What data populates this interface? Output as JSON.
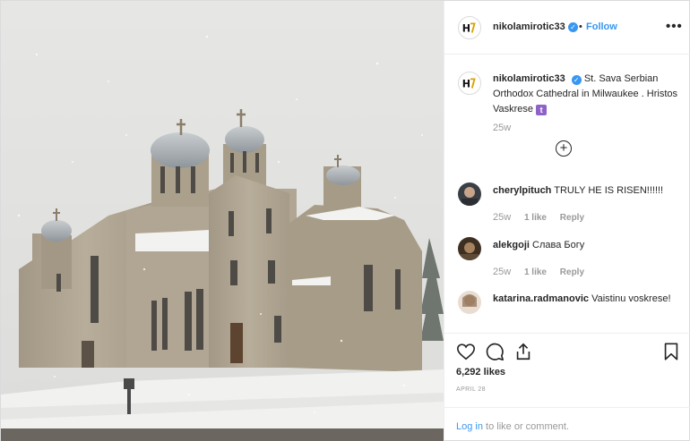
{
  "post": {
    "author": "nikolamirotic33",
    "follow_label": "Follow",
    "dot": "•",
    "more_label": "•••",
    "photo_alt": "St. Sava Serbian Orthodox Cathedral in the snow",
    "caption": {
      "username": "nikolamirotic33",
      "text": "St. Sava Serbian Orthodox Cathedral in Milwaukee . Hristos Vaskrese",
      "emoji_badge": "t",
      "time": "25w"
    },
    "load_more_label": "+",
    "comments": [
      {
        "username": "cherylpituch",
        "text": "TRULY HE IS RISEN!!!!!!",
        "time": "25w",
        "likes": "1 like",
        "reply": "Reply"
      },
      {
        "username": "alekgoji",
        "text": "Слава Богу",
        "time": "25w",
        "likes": "1 like",
        "reply": "Reply"
      },
      {
        "username": "katarina.radmanovic",
        "text": "Vaistinu voskrese!",
        "time": "",
        "likes": "",
        "reply": ""
      }
    ],
    "likes_count": "6,292 likes",
    "date": "APRIL 28",
    "login": {
      "link": "Log in",
      "rest": " to like or comment."
    }
  },
  "icons": {
    "avatar": "logo-avatar-icon",
    "verified": "verified-badge-icon",
    "like": "heart-icon",
    "comment": "comment-bubble-icon",
    "share": "share-icon",
    "save": "bookmark-icon"
  },
  "colors": {
    "accent": "#3897f0",
    "muted": "#999999",
    "text": "#262626",
    "border": "#dbdbdb"
  }
}
